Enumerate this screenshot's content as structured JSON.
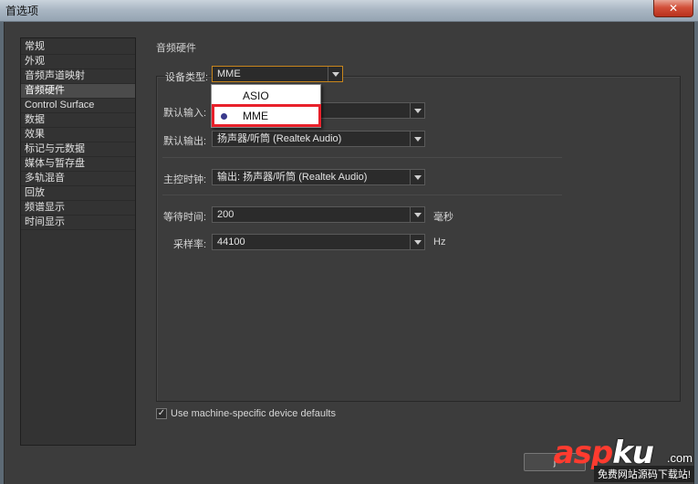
{
  "window": {
    "title": "首选项",
    "close_label": "✕"
  },
  "sidebar": {
    "items": [
      {
        "label": "常规",
        "selected": false
      },
      {
        "label": "外观",
        "selected": false
      },
      {
        "label": "音频声道映射",
        "selected": false
      },
      {
        "label": "音频硬件",
        "selected": true
      },
      {
        "label": "Control Surface",
        "selected": false
      },
      {
        "label": "数据",
        "selected": false
      },
      {
        "label": "效果",
        "selected": false
      },
      {
        "label": "标记与元数据",
        "selected": false
      },
      {
        "label": "媒体与暂存盘",
        "selected": false
      },
      {
        "label": "多轨混音",
        "selected": false
      },
      {
        "label": "回放",
        "selected": false
      },
      {
        "label": "频谱显示",
        "selected": false
      },
      {
        "label": "时间显示",
        "selected": false
      }
    ]
  },
  "section": {
    "title": "音频硬件"
  },
  "device_type": {
    "label": "设备类型:",
    "value": "MME"
  },
  "device_popup": {
    "options": [
      "ASIO",
      "MME"
    ],
    "selected_index": 1
  },
  "default_input": {
    "label": "默认输入:",
    "value": ""
  },
  "default_output": {
    "label": "默认输出:",
    "value": "扬声器/听筒 (Realtek Audio)"
  },
  "master_clock": {
    "label": "主控时钟:",
    "value": "输出: 扬声器/听筒 (Realtek Audio)"
  },
  "latency": {
    "label": "等待时间:",
    "value": "200",
    "unit": "毫秒"
  },
  "sample_rate": {
    "label": "采样率:",
    "value": "44100",
    "unit": "Hz"
  },
  "machine_defaults": {
    "label": "Use machine-specific device defaults",
    "checked": true,
    "check_glyph": "✓"
  },
  "buttons": {
    "ok_label": "j"
  },
  "watermark": {
    "logo_a": "asp",
    "logo_b": "ku",
    "domain_suffix": ".com",
    "subtitle": "免费网站源码下载站!"
  },
  "colors": {
    "accent_focus": "#c8861c",
    "highlight": "#e8202a",
    "panel_bg": "#3c3c3c"
  }
}
